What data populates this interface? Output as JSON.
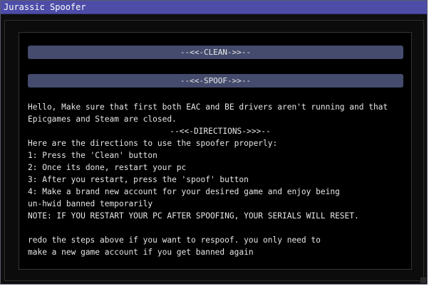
{
  "window": {
    "title": "Jurassic Spoofer"
  },
  "buttons": {
    "clean_label": "--<<-CLEAN->>--",
    "spoof_label": "--<<-SPOOF->>--"
  },
  "text": {
    "lines": [
      "Hello, Make sure that first both EAC and BE drivers aren't running and that",
      "Epicgames and Steam are closed.",
      "--<<-DIRECTIONS->>>--",
      "Here are the directions to use the spoofer properly:",
      "1: Press the 'Clean' button",
      "2: Once its done, restart your pc",
      "3: After you restart, press the 'spoof' button",
      "4: Make a brand new account for your desired game and enjoy being",
      "un-hwid banned temporarily",
      "NOTE: IF YOU RESTART YOUR PC AFTER SPOOFING, YOUR SERIALS WILL RESET.",
      "",
      "redo the steps above if you want to respoof. you only need to",
      "make a new game account if you get banned again"
    ]
  },
  "colors": {
    "titlebar": "#4d4da8",
    "button": "#444b6c",
    "background": "#000000",
    "text": "#e6e6e6"
  }
}
